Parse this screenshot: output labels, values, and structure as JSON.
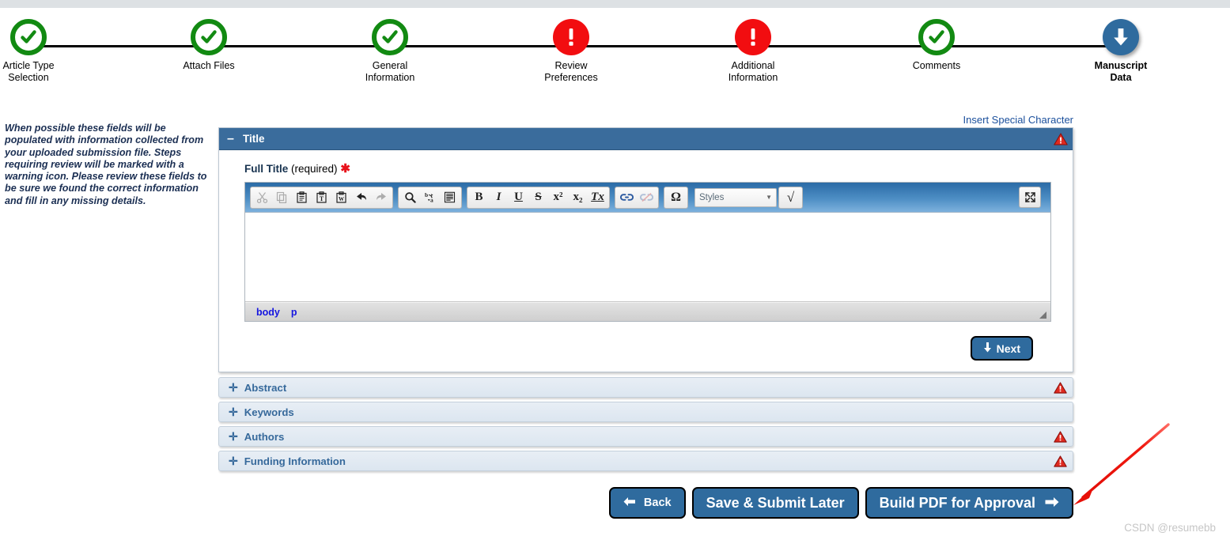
{
  "stepper": {
    "steps": [
      {
        "label_line1": "Article Type",
        "label_line2": "Selection",
        "state": "done",
        "icon": "check-circle-icon"
      },
      {
        "label_line1": "Attach Files",
        "label_line2": "",
        "state": "done",
        "icon": "check-circle-icon"
      },
      {
        "label_line1": "General",
        "label_line2": "Information",
        "state": "done",
        "icon": "check-circle-icon"
      },
      {
        "label_line1": "Review",
        "label_line2": "Preferences",
        "state": "warn",
        "icon": "exclamation-circle-icon"
      },
      {
        "label_line1": "Additional",
        "label_line2": "Information",
        "state": "warn",
        "icon": "exclamation-circle-icon"
      },
      {
        "label_line1": "Comments",
        "label_line2": "",
        "state": "done",
        "icon": "check-circle-icon"
      },
      {
        "label_line1": "Manuscript",
        "label_line2": "Data",
        "state": "current",
        "icon": "arrow-down-circle-icon"
      }
    ]
  },
  "help_note": {
    "text": "When possible these fields will be populated with information collected from your uploaded submission file. Steps requiring review will be marked with a warning icon. Please review these fields to be sure we found the correct information and fill in any missing details."
  },
  "special_character_link": "Insert Special Character",
  "title_panel": {
    "header_title": "Title",
    "collapse_glyph": "–",
    "warning_icon": "warning-triangle-icon",
    "field": {
      "label_strong": "Full Title",
      "label_required": "(required)",
      "asterisk": "✱"
    },
    "editor": {
      "content": "",
      "styles_placeholder": "Styles",
      "element_path": [
        "body",
        "p"
      ],
      "toolbar_groups": [
        {
          "name": "clipboard",
          "buttons": [
            {
              "name": "cut-icon",
              "title": "Cut",
              "disabled": true
            },
            {
              "name": "copy-icon",
              "title": "Copy",
              "disabled": true
            },
            {
              "name": "paste-icon",
              "title": "Paste",
              "disabled": false
            },
            {
              "name": "paste-text-icon",
              "title": "Paste as plain text",
              "disabled": false
            },
            {
              "name": "paste-word-icon",
              "title": "Paste from Word",
              "disabled": false
            },
            {
              "name": "undo-icon",
              "title": "Undo",
              "disabled": false
            },
            {
              "name": "redo-icon",
              "title": "Redo",
              "disabled": true
            }
          ]
        },
        {
          "name": "editing",
          "buttons": [
            {
              "name": "find-icon",
              "title": "Find",
              "disabled": false
            },
            {
              "name": "replace-icon",
              "title": "Replace",
              "disabled": false
            },
            {
              "name": "select-all-icon",
              "title": "Select All",
              "disabled": false
            }
          ]
        },
        {
          "name": "basicstyles",
          "buttons": [
            {
              "name": "bold-icon",
              "title": "Bold",
              "glyph": "B",
              "disabled": false
            },
            {
              "name": "italic-icon",
              "title": "Italic",
              "glyph": "I",
              "disabled": false
            },
            {
              "name": "underline-icon",
              "title": "Underline",
              "glyph": "U",
              "disabled": false
            },
            {
              "name": "strikethrough-icon",
              "title": "Strike Through",
              "glyph": "S",
              "disabled": false
            },
            {
              "name": "superscript-icon",
              "title": "Superscript",
              "glyph": "x²",
              "disabled": false
            },
            {
              "name": "subscript-icon",
              "title": "Subscript",
              "glyph": "x₂",
              "disabled": false
            },
            {
              "name": "remove-format-icon",
              "title": "Remove Format",
              "glyph": "Tx",
              "disabled": false
            }
          ]
        },
        {
          "name": "links",
          "buttons": [
            {
              "name": "link-icon",
              "title": "Link",
              "disabled": false
            },
            {
              "name": "unlink-icon",
              "title": "Unlink",
              "disabled": true
            }
          ]
        },
        {
          "name": "insert",
          "buttons": [
            {
              "name": "special-character-icon",
              "title": "Insert Special Character",
              "glyph": "Ω",
              "disabled": false
            }
          ]
        },
        {
          "name": "tools",
          "buttons": [
            {
              "name": "math-radical-icon",
              "title": "Insert Math",
              "glyph": "√",
              "disabled": false
            }
          ]
        }
      ],
      "maximize_icon": "maximize-icon",
      "resize_grip": "resize-grip-icon"
    },
    "next_button": {
      "label": "Next",
      "icon": "arrow-down-icon"
    }
  },
  "accordions": [
    {
      "title": "Abstract",
      "expand_glyph": "✛",
      "warning": true,
      "warning_icon": "warning-triangle-icon"
    },
    {
      "title": "Keywords",
      "expand_glyph": "✛",
      "warning": false,
      "warning_icon": ""
    },
    {
      "title": "Authors",
      "expand_glyph": "✛",
      "warning": true,
      "warning_icon": "warning-triangle-icon"
    },
    {
      "title": "Funding Information",
      "expand_glyph": "✛",
      "warning": true,
      "warning_icon": "warning-triangle-icon"
    }
  ],
  "bottom_actions": {
    "back": {
      "label": "Back",
      "icon": "arrow-left-icon"
    },
    "save_submit_later": {
      "label": "Save & Submit Later"
    },
    "build_pdf": {
      "label": "Build PDF for Approval",
      "icon": "arrow-right-icon"
    }
  },
  "annotation": {
    "type": "red-arrow",
    "color": "#ee1111"
  },
  "watermark": "CSDN @resumebb",
  "colors": {
    "panel_header_blue": "#3a6c9c",
    "button_blue": "#2f6b9e",
    "accordion_blue_text": "#36699b",
    "done_green": "#128a12",
    "warn_red": "#f20d10",
    "link_blue": "#1a4f9c",
    "element_path_blue": "#1515e0"
  }
}
